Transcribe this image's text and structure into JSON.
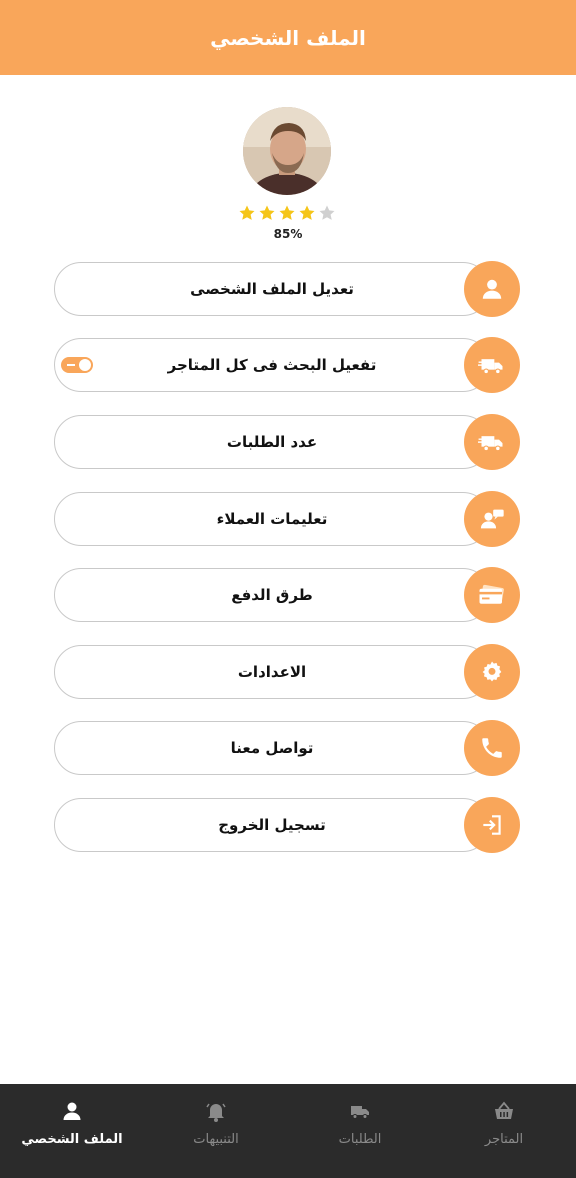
{
  "header": {
    "title": "الملف الشخصي"
  },
  "profile": {
    "rating_percent": "85%",
    "stars_filled": 4,
    "stars_total": 5
  },
  "menu": [
    {
      "label": "تعديل الملف الشخصى",
      "icon": "user-icon"
    },
    {
      "label": "تفعيل البحث فى كل المتاجر",
      "icon": "delivery-truck-icon",
      "toggle_on": true
    },
    {
      "label": "عدد الطلبات",
      "icon": "delivery-truck-icon"
    },
    {
      "label": "تعليمات العملاء",
      "icon": "customer-message-icon"
    },
    {
      "label": "طرق الدفع",
      "icon": "credit-card-icon"
    },
    {
      "label": "الاعدادات",
      "icon": "gear-icon"
    },
    {
      "label": "تواصل معنا",
      "icon": "phone-icon"
    },
    {
      "label": "تسجيل الخروج",
      "icon": "logout-icon"
    }
  ],
  "bottom_nav": [
    {
      "label": "المتاجر",
      "icon": "basket-icon",
      "active": false
    },
    {
      "label": "الطلبات",
      "icon": "delivery-truck-icon",
      "active": false
    },
    {
      "label": "التنبيهات",
      "icon": "bell-icon",
      "active": false
    },
    {
      "label": "الملف الشخصي",
      "icon": "user-icon",
      "active": true
    }
  ],
  "colors": {
    "accent": "#f9a65a",
    "nav_bg": "#2b2b2b",
    "star": "#f5c518"
  }
}
